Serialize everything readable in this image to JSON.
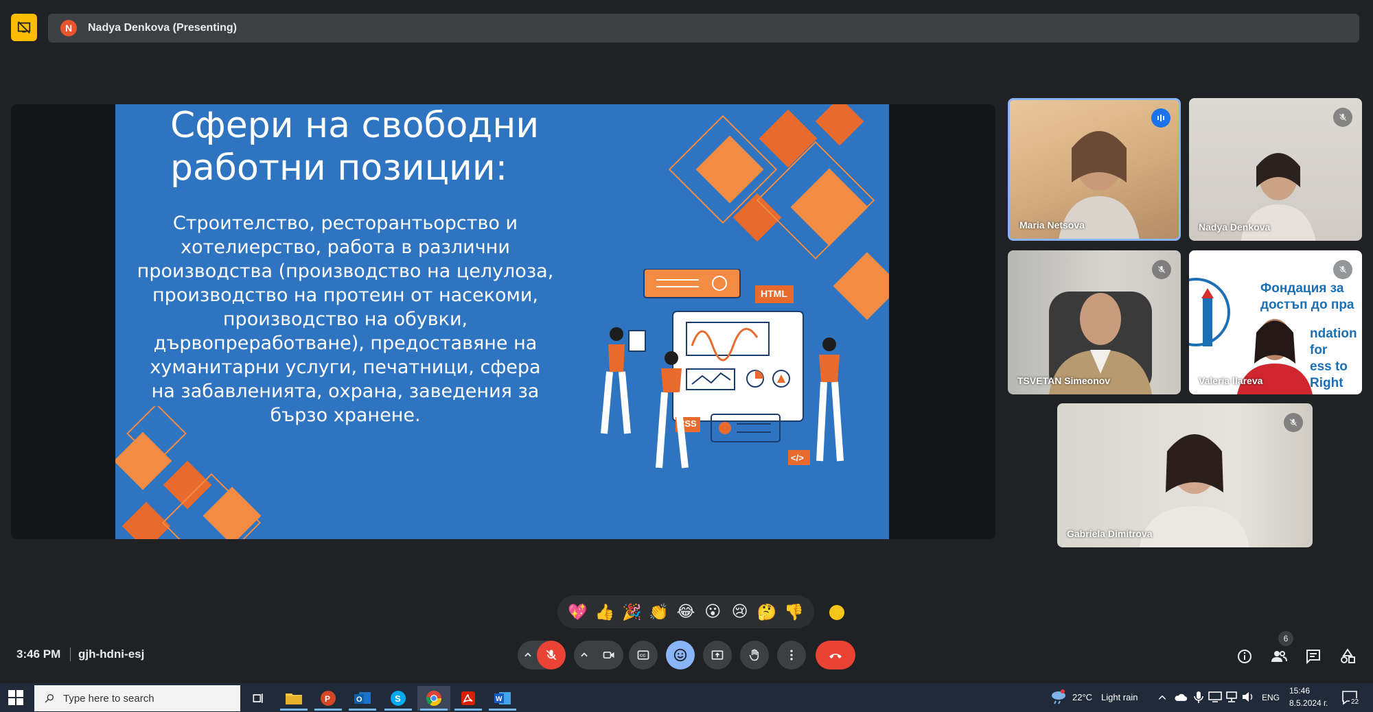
{
  "presenting": {
    "avatar_letter": "N",
    "label": "Nadya Denkova (Presenting)"
  },
  "slide": {
    "title_line1": "Сфери на свободни",
    "title_line2": "работни позиции:",
    "body": "Строителство, ресторантьорство и хотелиерство, работа в различни производства (производство на целулоза, производство на протеин от насекоми, производство на обувки, дървопреработване), предоставяне на хуманитарни услуги, печатници, сфера на забавленията, охрана, заведения за бързо хранене.",
    "tag_html": "HTML",
    "tag_css": "CSS",
    "tag_code": "</>"
  },
  "participants": [
    {
      "name": "Maria Netsova",
      "state": "speaking"
    },
    {
      "name": "Nadya Denkova",
      "state": "muted"
    },
    {
      "name": "TSVETAN Simeonov",
      "state": "muted"
    },
    {
      "name": "Valeria Ilareva",
      "state": "muted",
      "banner_line1": "Фондация за",
      "banner_line2": "достъп до пра",
      "banner_line3": "ndation for",
      "banner_line4": "ess to Right"
    },
    {
      "name": "Gabriela Dimitrova",
      "state": "muted"
    }
  ],
  "reactions": [
    "💖",
    "👍",
    "🎉",
    "👏",
    "😂",
    "😮",
    "😢",
    "🤔",
    "👎"
  ],
  "meeting": {
    "time": "3:46 PM",
    "code": "gjh-hdni-esj",
    "people_count": "6"
  },
  "taskbar": {
    "search_placeholder": "Type here to search",
    "weather_temp": "22°C",
    "weather_text": "Light rain",
    "lang": "ENG",
    "clock_time": "15:46",
    "clock_date": "8.5.2024 г.",
    "notif_count": "22"
  },
  "colors": {
    "slide_bg": "#2f74c0",
    "slide_orange": "#f28c45",
    "speaking_blue": "#1a73e8",
    "end_call_red": "#ea4335"
  }
}
